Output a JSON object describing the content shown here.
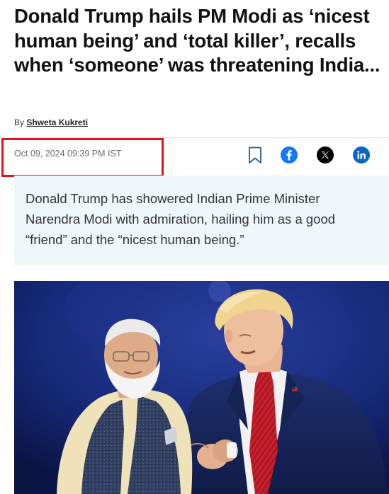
{
  "article": {
    "headline": "Donald Trump hails PM Modi as ‘nicest human being’ and ‘total killer’, recalls when ‘someone’ was threatening India...",
    "byline_prefix": "By",
    "author": "Shweta Kukreti",
    "date": "Oct 09, 2024 09:39 PM IST",
    "summary": "Donald Trump has showered Indian Prime Minister Narendra Modi with admiration, hailing him as a good “friend” and the “nicest human being.”"
  },
  "share": {
    "icons": [
      "bookmark-icon",
      "facebook-icon",
      "x-icon",
      "linkedin-icon"
    ]
  },
  "colors": {
    "highlight_border": "#e0151c",
    "summary_bg": "#eef8fb",
    "facebook": "#1877f2",
    "linkedin": "#0a66c2",
    "x": "#000000",
    "bookmark": "#2f5a8a"
  }
}
